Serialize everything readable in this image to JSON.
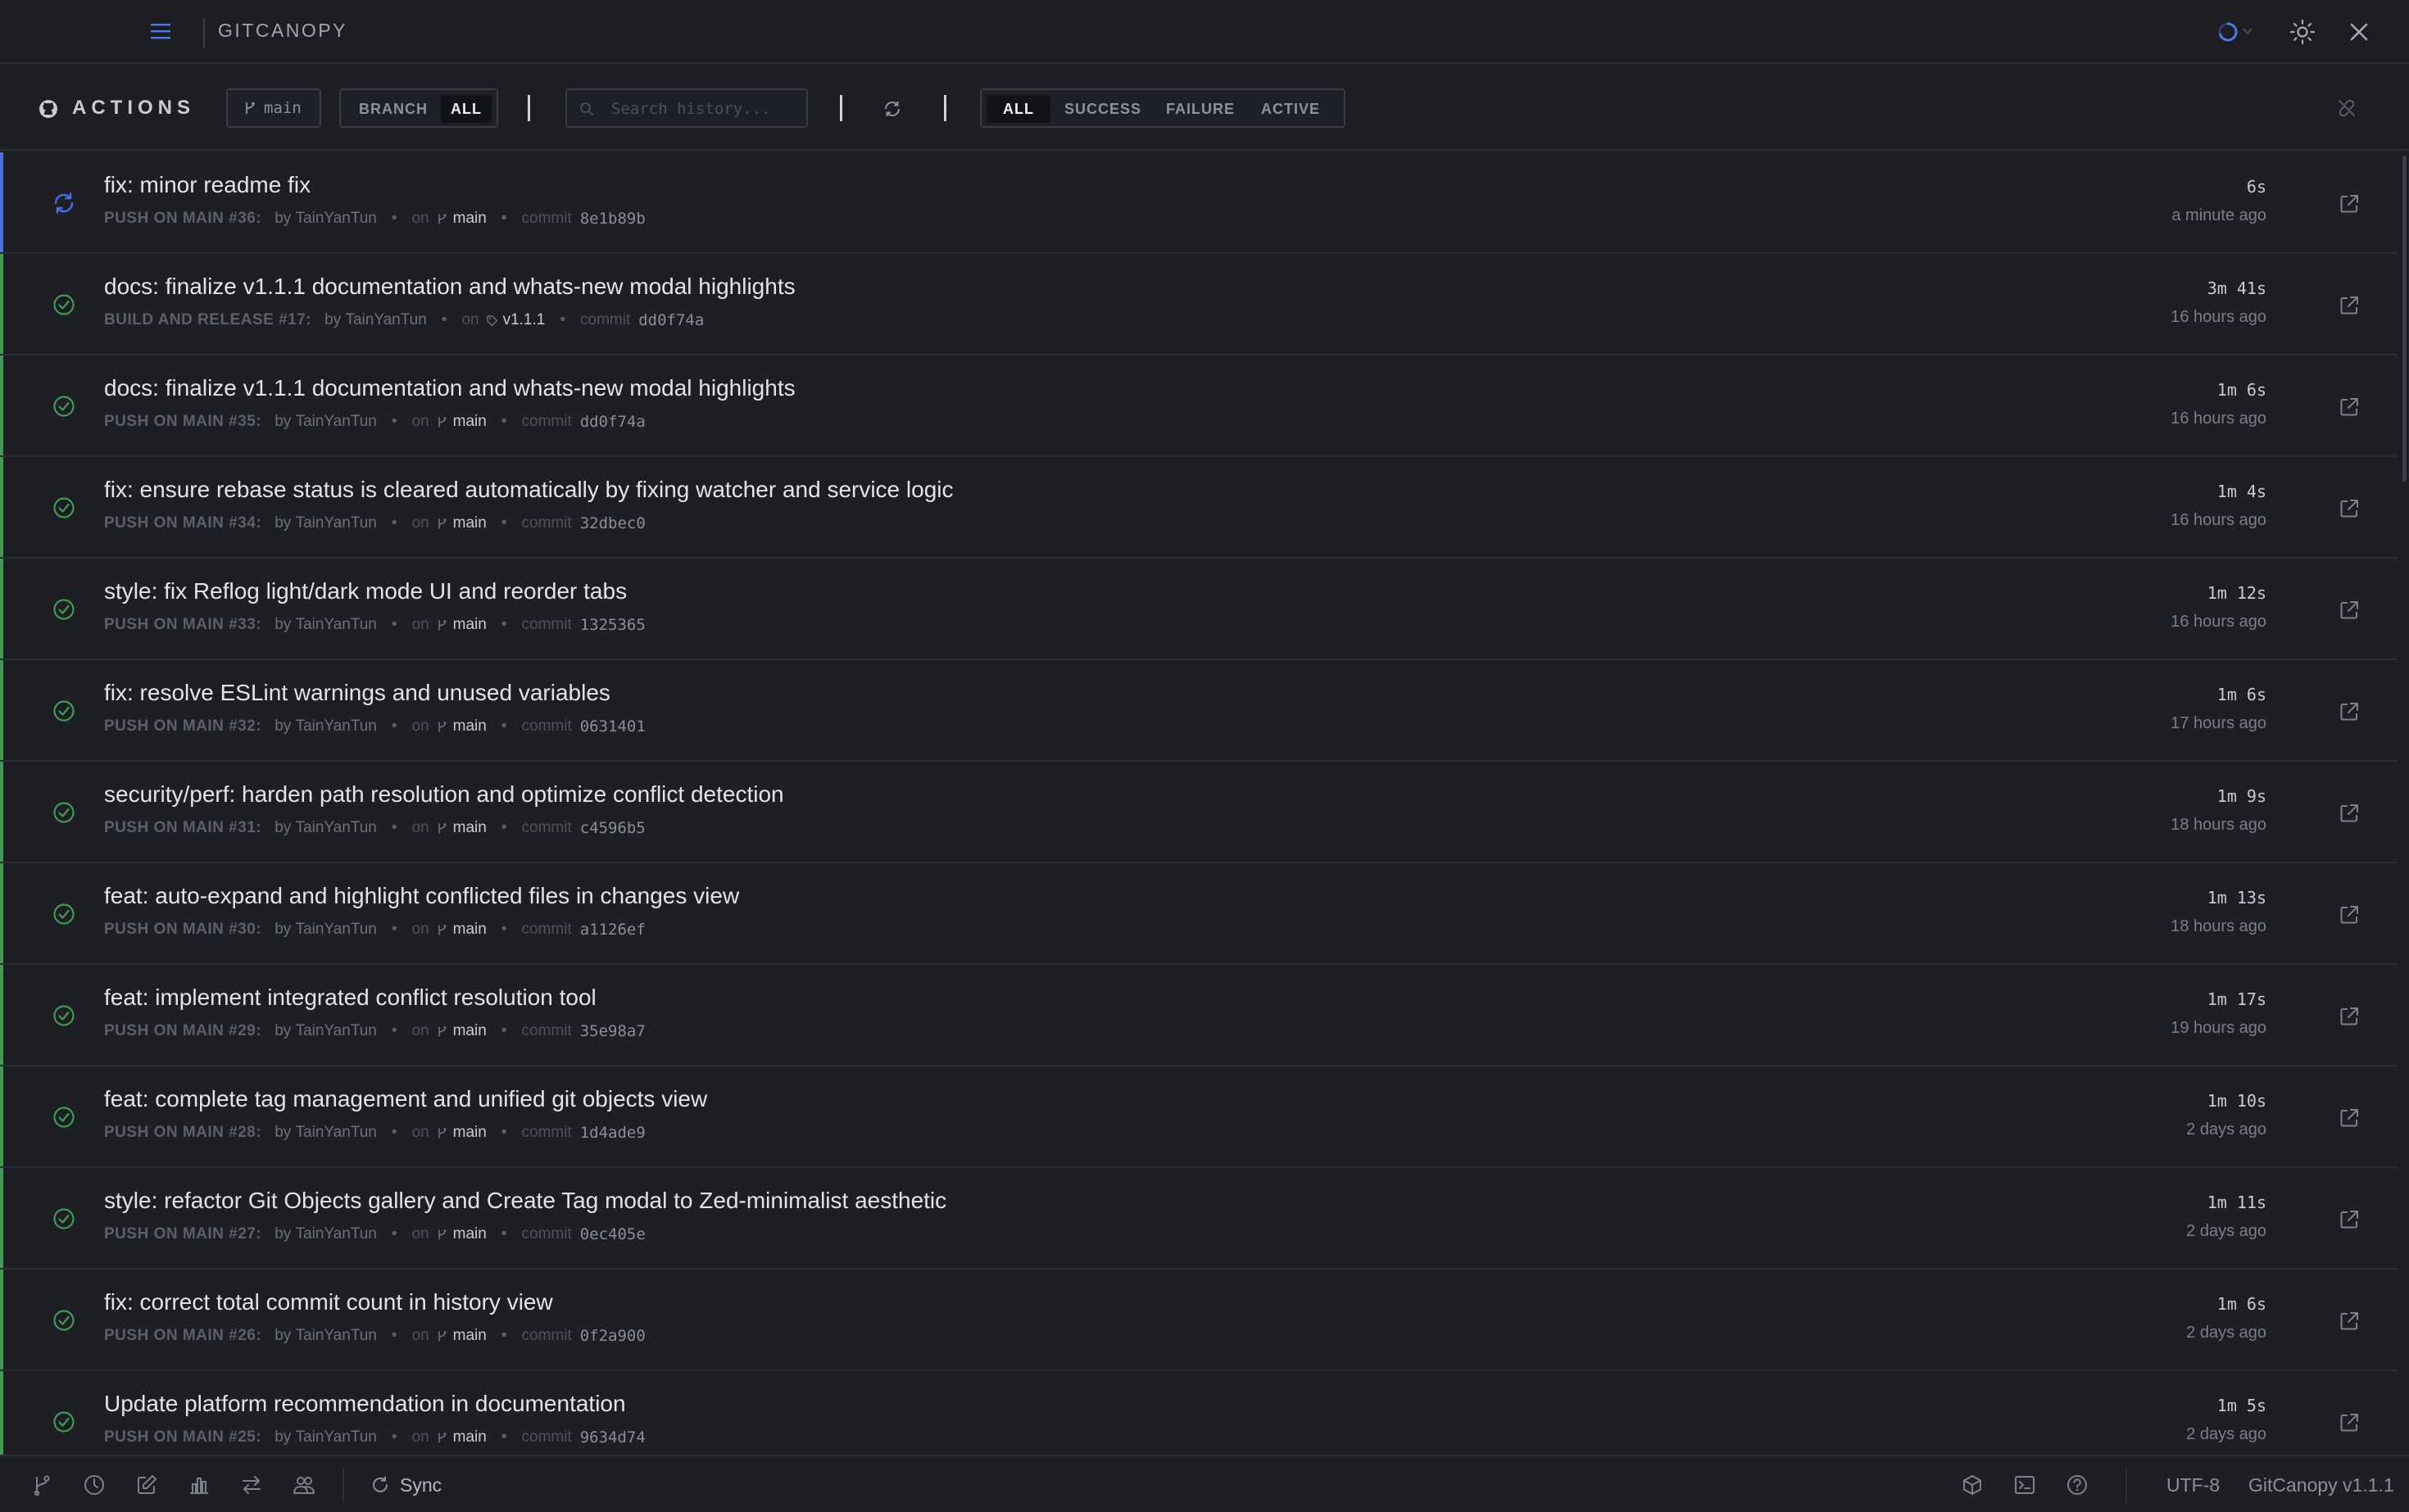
{
  "app": {
    "title": "GITCANOPY"
  },
  "toolbar": {
    "title": "ACTIONS",
    "branch": "main",
    "scope": [
      "BRANCH",
      "ALL"
    ],
    "search_placeholder": "Search history...",
    "filters": [
      "ALL",
      "SUCCESS",
      "FAILURE",
      "ACTIVE"
    ],
    "selected_filter": "ALL",
    "selected_scope": "ALL"
  },
  "colors": {
    "success": "#3f9a54",
    "active": "#4a6ee0",
    "background": "#1c1e24"
  },
  "runs": [
    {
      "status": "active",
      "title": "fix: minor readme fix",
      "workflow": "PUSH ON MAIN #36:",
      "author": "TainYanTun",
      "ref_type": "branch",
      "ref": "main",
      "commit": "8e1b89b",
      "duration": "6s",
      "ago": "a minute ago"
    },
    {
      "status": "success",
      "title": "docs: finalize v1.1.1 documentation and whats-new modal highlights",
      "workflow": "BUILD AND RELEASE #17:",
      "author": "TainYanTun",
      "ref_type": "tag",
      "ref": "v1.1.1",
      "commit": "dd0f74a",
      "duration": "3m 41s",
      "ago": "16 hours ago"
    },
    {
      "status": "success",
      "title": "docs: finalize v1.1.1 documentation and whats-new modal highlights",
      "workflow": "PUSH ON MAIN #35:",
      "author": "TainYanTun",
      "ref_type": "branch",
      "ref": "main",
      "commit": "dd0f74a",
      "duration": "1m 6s",
      "ago": "16 hours ago"
    },
    {
      "status": "success",
      "title": "fix: ensure rebase status is cleared automatically by fixing watcher and service logic",
      "workflow": "PUSH ON MAIN #34:",
      "author": "TainYanTun",
      "ref_type": "branch",
      "ref": "main",
      "commit": "32dbec0",
      "duration": "1m 4s",
      "ago": "16 hours ago"
    },
    {
      "status": "success",
      "title": "style: fix Reflog light/dark mode UI and reorder tabs",
      "workflow": "PUSH ON MAIN #33:",
      "author": "TainYanTun",
      "ref_type": "branch",
      "ref": "main",
      "commit": "1325365",
      "duration": "1m 12s",
      "ago": "16 hours ago"
    },
    {
      "status": "success",
      "title": "fix: resolve ESLint warnings and unused variables",
      "workflow": "PUSH ON MAIN #32:",
      "author": "TainYanTun",
      "ref_type": "branch",
      "ref": "main",
      "commit": "0631401",
      "duration": "1m 6s",
      "ago": "17 hours ago"
    },
    {
      "status": "success",
      "title": "security/perf: harden path resolution and optimize conflict detection",
      "workflow": "PUSH ON MAIN #31:",
      "author": "TainYanTun",
      "ref_type": "branch",
      "ref": "main",
      "commit": "c4596b5",
      "duration": "1m 9s",
      "ago": "18 hours ago"
    },
    {
      "status": "success",
      "title": "feat: auto-expand and highlight conflicted files in changes view",
      "workflow": "PUSH ON MAIN #30:",
      "author": "TainYanTun",
      "ref_type": "branch",
      "ref": "main",
      "commit": "a1126ef",
      "duration": "1m 13s",
      "ago": "18 hours ago"
    },
    {
      "status": "success",
      "title": "feat: implement integrated conflict resolution tool",
      "workflow": "PUSH ON MAIN #29:",
      "author": "TainYanTun",
      "ref_type": "branch",
      "ref": "main",
      "commit": "35e98a7",
      "duration": "1m 17s",
      "ago": "19 hours ago"
    },
    {
      "status": "success",
      "title": "feat: complete tag management and unified git objects view",
      "workflow": "PUSH ON MAIN #28:",
      "author": "TainYanTun",
      "ref_type": "branch",
      "ref": "main",
      "commit": "1d4ade9",
      "duration": "1m 10s",
      "ago": "2 days ago"
    },
    {
      "status": "success",
      "title": "style: refactor Git Objects gallery and Create Tag modal to Zed-minimalist aesthetic",
      "workflow": "PUSH ON MAIN #27:",
      "author": "TainYanTun",
      "ref_type": "branch",
      "ref": "main",
      "commit": "0ec405e",
      "duration": "1m 11s",
      "ago": "2 days ago"
    },
    {
      "status": "success",
      "title": "fix: correct total commit count in history view",
      "workflow": "PUSH ON MAIN #26:",
      "author": "TainYanTun",
      "ref_type": "branch",
      "ref": "main",
      "commit": "0f2a900",
      "duration": "1m 6s",
      "ago": "2 days ago"
    },
    {
      "status": "success",
      "title": "Update platform recommendation in documentation",
      "workflow": "PUSH ON MAIN #25:",
      "author": "TainYanTun",
      "ref_type": "branch",
      "ref": "main",
      "commit": "9634d74",
      "duration": "1m 5s",
      "ago": "2 days ago"
    }
  ],
  "labels": {
    "by": "by",
    "on": "on",
    "commit": "commit",
    "separator": "•"
  },
  "statusbar": {
    "icons": [
      "branch-icon",
      "history-icon",
      "edit-icon",
      "chart-icon",
      "swap-icon",
      "users-icon"
    ],
    "sync_label": "Sync",
    "right_icons": [
      "package-icon",
      "terminal-icon",
      "help-icon"
    ],
    "encoding": "UTF-8",
    "version": "GitCanopy v1.1.1"
  }
}
